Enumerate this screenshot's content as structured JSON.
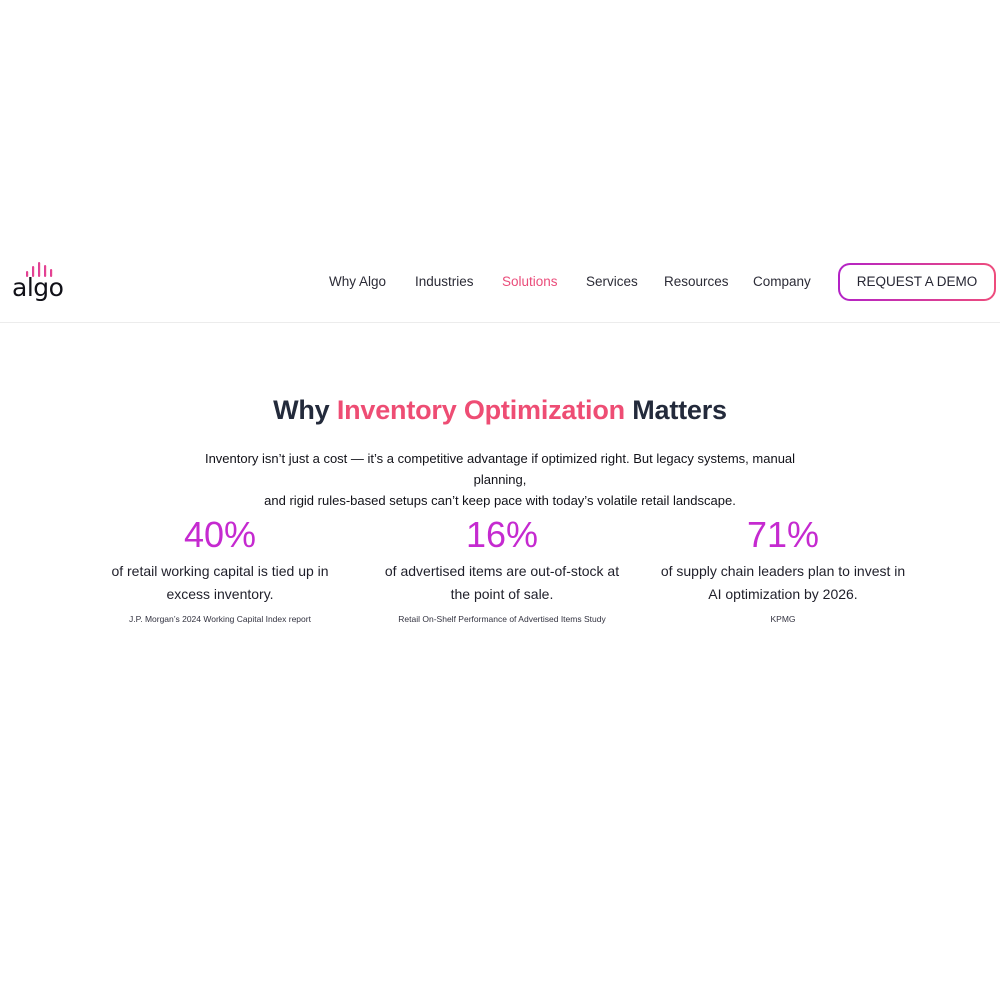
{
  "header": {
    "logo_text": "algo",
    "nav": [
      {
        "label": "Why Algo",
        "active": false
      },
      {
        "label": "Industries",
        "active": false
      },
      {
        "label": "Solutions",
        "active": true
      },
      {
        "label": "Services",
        "active": false
      },
      {
        "label": "Resources",
        "active": false
      },
      {
        "label": "Company",
        "active": false
      }
    ],
    "cta_label": "REQUEST A DEMO"
  },
  "section": {
    "title_pre": "Why ",
    "title_accent": "Inventory Optimization",
    "title_post": " Matters",
    "intro_line1": "Inventory isn’t just a cost — it’s a competitive advantage if optimized right. But legacy systems, manual planning,",
    "intro_line2": "and rigid rules-based setups can’t keep pace with today’s volatile retail landscape.",
    "stats": [
      {
        "value": "40%",
        "desc_line1": "of retail working capital is tied up in",
        "desc_line2": "excess inventory.",
        "source": "J.P. Morgan’s 2024 Working Capital Index report"
      },
      {
        "value": "16%",
        "desc_line1": "of advertised items are out-of-stock at",
        "desc_line2": "the point of sale.",
        "source": "Retail On-Shelf Performance of Advertised Items Study"
      },
      {
        "value": "71%",
        "desc_line1": "of supply chain leaders plan to invest in",
        "desc_line2": "AI optimization by 2026.",
        "source": "KPMG"
      }
    ]
  },
  "colors": {
    "brand_pink": "#ee4d74",
    "stat_magenta": "#c52ad0",
    "heading_dark": "#232a3b"
  }
}
